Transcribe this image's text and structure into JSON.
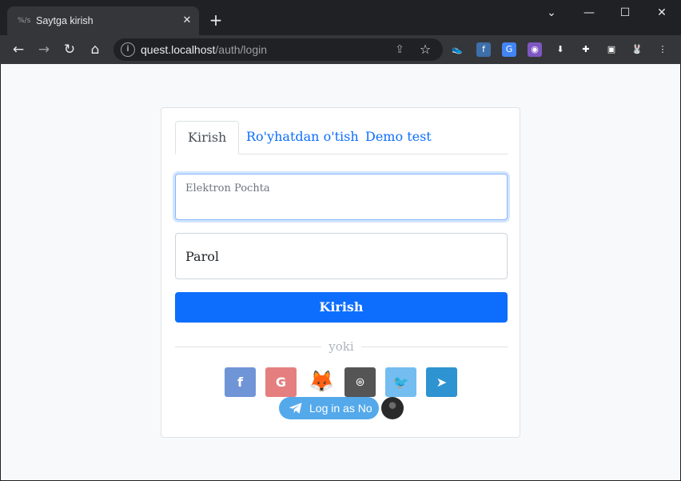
{
  "browser": {
    "tab_title": "Saytga kirish",
    "tab_favicon_text": "%/s",
    "tab_close": "✕",
    "new_tab": "+",
    "window_controls": {
      "dropdown": "⌄",
      "minimize": "—",
      "maximize": "☐",
      "close": "✕"
    },
    "nav": {
      "back": "←",
      "forward": "→",
      "reload": "↻",
      "home": "⌂"
    },
    "url_host": "quest.localhost",
    "url_path": "/auth/login",
    "omnibox_icons": {
      "info": "i",
      "share": "⇪",
      "bookmark": "☆"
    },
    "extensions": [
      {
        "name": "shoe-extension-icon",
        "glyph": "👟",
        "bg": "#35363a"
      },
      {
        "name": "f-extension-icon",
        "glyph": "f",
        "bg": "#3d6fa8"
      },
      {
        "name": "google-translate-extension-icon",
        "glyph": "G",
        "bg": "#4285f4"
      },
      {
        "name": "ghost-extension-icon",
        "glyph": "◉",
        "bg": "#7e57c2"
      },
      {
        "name": "download-extension-icon",
        "glyph": "⬇",
        "bg": "#35363a"
      },
      {
        "name": "puzzle-extensions-icon",
        "glyph": "✚",
        "bg": "#35363a"
      },
      {
        "name": "sidepanel-icon",
        "glyph": "▣",
        "bg": "#35363a"
      },
      {
        "name": "profile-avatar-icon",
        "glyph": "🐰",
        "bg": "#35363a"
      },
      {
        "name": "menu-kebab-icon",
        "glyph": "⋮",
        "bg": "#35363a"
      }
    ]
  },
  "login": {
    "tabs": [
      {
        "label": "Kirish"
      },
      {
        "label": "Ro'yhatdan o'tish"
      },
      {
        "label": "Demo test"
      }
    ],
    "email_placeholder": "Elektron Pochta",
    "password_label": "Parol",
    "submit_label": "Kirish",
    "divider_text": "yoki",
    "socials": [
      {
        "name": "facebook",
        "glyph": "f",
        "color": "#6f95d7"
      },
      {
        "name": "google",
        "glyph": "G",
        "color": "#e57f7f"
      },
      {
        "name": "metamask",
        "glyph": "🦊",
        "color": "transparent"
      },
      {
        "name": "github",
        "glyph": "⌾",
        "color": "#555555"
      },
      {
        "name": "twitter",
        "glyph": "🐦",
        "color": "#74bdf0"
      },
      {
        "name": "telegram",
        "glyph": "➤",
        "color": "#2e93d1"
      }
    ],
    "telegram_login_label": "Log in as No"
  },
  "colors": {
    "primary": "#0d6efd",
    "page_bg": "#f8f9fa",
    "chrome_dark": "#202124",
    "chrome_toolbar": "#35363a",
    "telegram_blue": "#54a9eb"
  }
}
